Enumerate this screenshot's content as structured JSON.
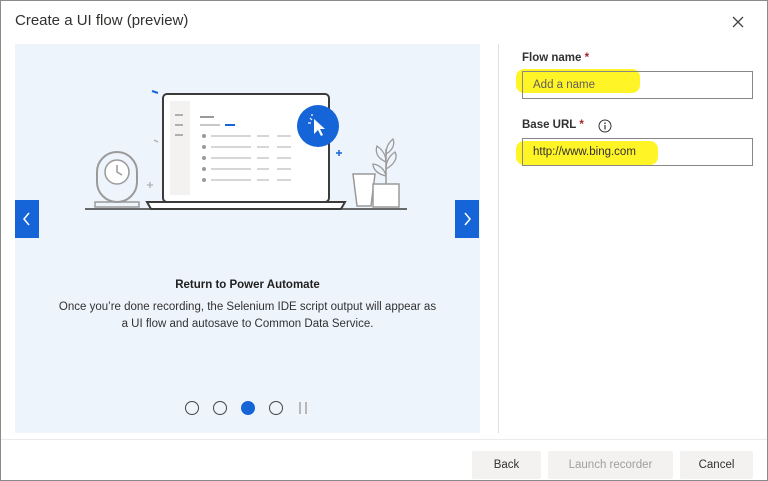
{
  "dialog": {
    "title": "Create a UI flow (preview)"
  },
  "carousel": {
    "slide_title": "Return to Power Automate",
    "slide_description": "Once you’re done recording, the Selenium IDE script output will appear as a UI flow and autosave to Common Data Service.",
    "total_slides": 4,
    "active_slide": 3,
    "accent_color": "#1565d8"
  },
  "form": {
    "flow_name": {
      "label": "Flow name",
      "required_mark": "*",
      "placeholder": "Add a name",
      "value": ""
    },
    "base_url": {
      "label": "Base URL",
      "required_mark": "*",
      "value": "http://www.bing.com",
      "info_icon": "info-icon"
    }
  },
  "footer": {
    "back_label": "Back",
    "launch_label": "Launch recorder",
    "cancel_label": "Cancel"
  }
}
